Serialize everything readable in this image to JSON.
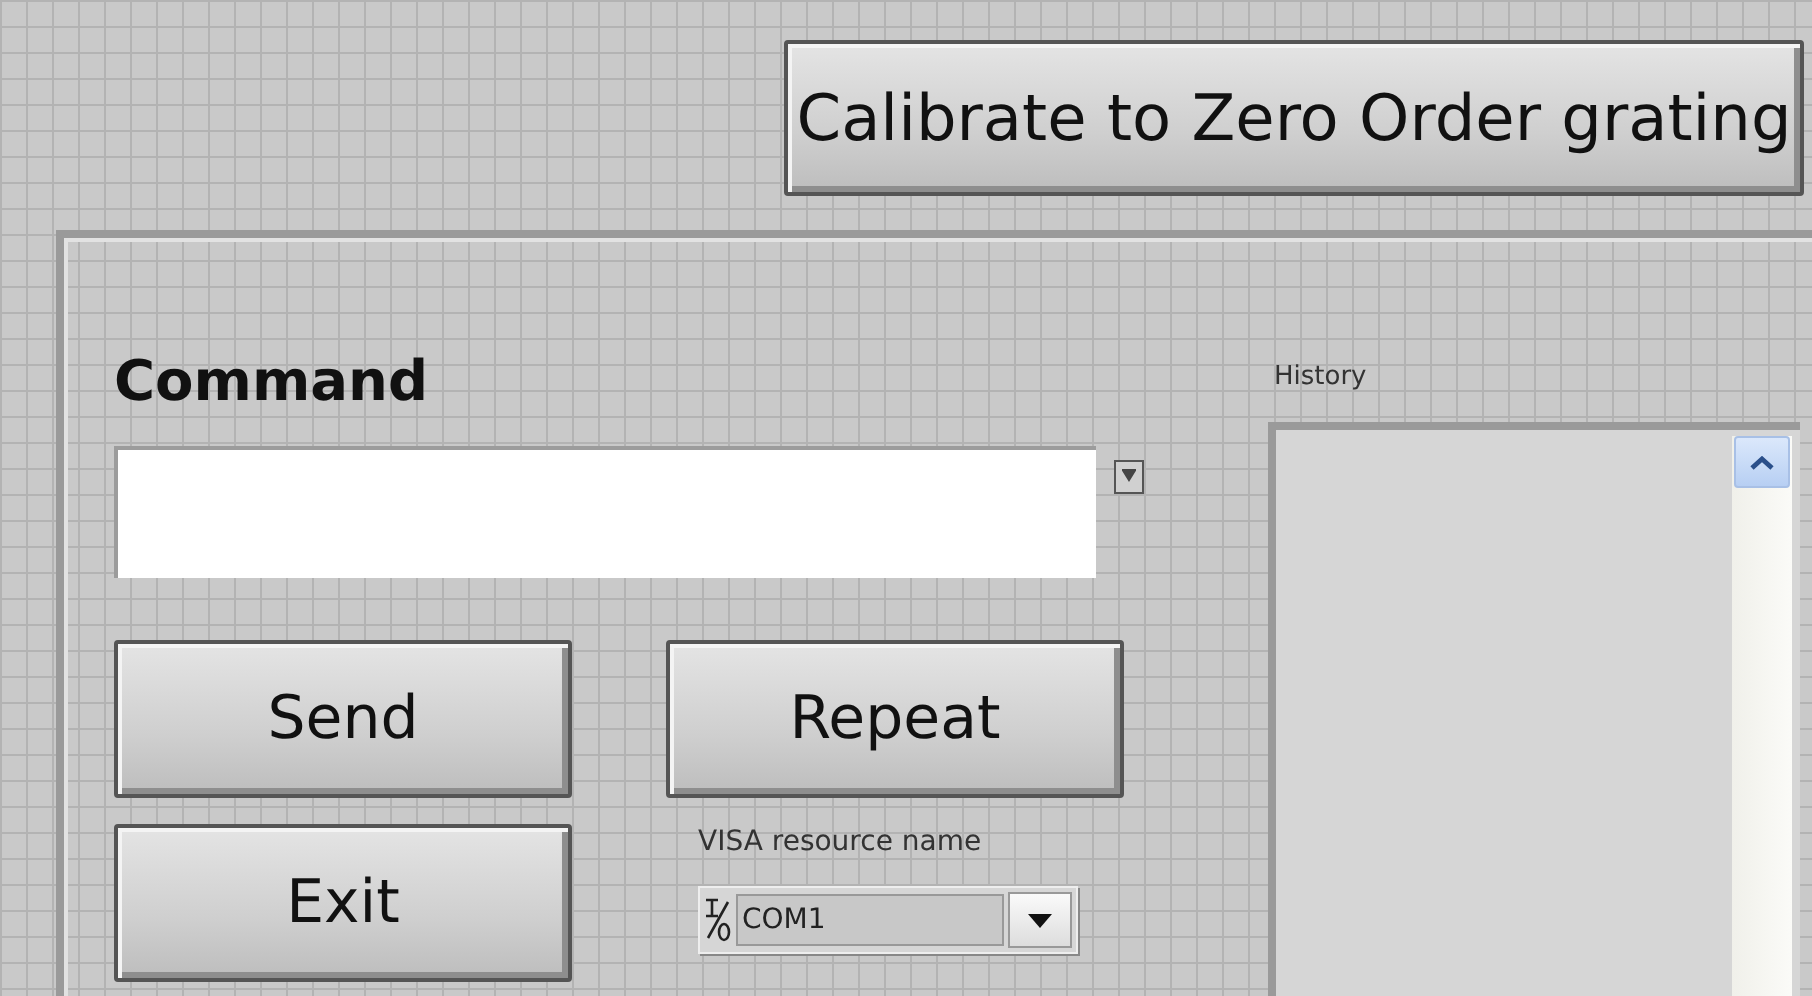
{
  "calibrate_button": {
    "label": "Calibrate to Zero Order grating"
  },
  "command": {
    "label": "Command"
  },
  "buttons": [
    {
      "label": "Send"
    },
    {
      "label": "Repeat"
    },
    {
      "label": "Exit"
    }
  ],
  "visa_resource": {
    "label": "VISA resource name",
    "value": "COM1"
  },
  "history": {
    "label": "History"
  }
}
